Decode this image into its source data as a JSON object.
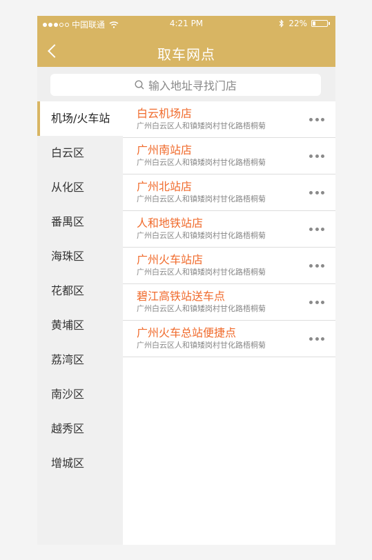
{
  "status": {
    "carrier": "中国联通",
    "time": "4:21 PM",
    "battery": "22%",
    "battery_level": 0.22
  },
  "header": {
    "title": "取车网点"
  },
  "search": {
    "placeholder": "输入地址寻找门店"
  },
  "sidebar": {
    "items": [
      {
        "label": "机场/火车站",
        "active": true
      },
      {
        "label": "白云区"
      },
      {
        "label": "从化区"
      },
      {
        "label": "番禺区"
      },
      {
        "label": "海珠区"
      },
      {
        "label": "花都区"
      },
      {
        "label": "黄埔区"
      },
      {
        "label": "荔湾区"
      },
      {
        "label": "南沙区"
      },
      {
        "label": "越秀区"
      },
      {
        "label": "增城区"
      }
    ]
  },
  "stores": [
    {
      "name": "白云机场店",
      "address": "广州白云区人和镇矮岗村甘化路梧桐菊"
    },
    {
      "name": "广州南站店",
      "address": "广州白云区人和镇矮岗村甘化路梧桐菊"
    },
    {
      "name": "广州北站店",
      "address": "广州白云区人和镇矮岗村甘化路梧桐菊"
    },
    {
      "name": "人和地铁站店",
      "address": "广州白云区人和镇矮岗村甘化路梧桐菊"
    },
    {
      "name": "广州火车站店",
      "address": "广州白云区人和镇矮岗村甘化路梧桐菊"
    },
    {
      "name": "碧江高铁站送车点",
      "address": "广州白云区人和镇矮岗村甘化路梧桐菊"
    },
    {
      "name": "广州火车总站便捷点",
      "address": "广州白云区人和镇矮岗村甘化路梧桐菊"
    }
  ],
  "colors": {
    "accent": "#d8b563",
    "store_name": "#f06a2b"
  }
}
